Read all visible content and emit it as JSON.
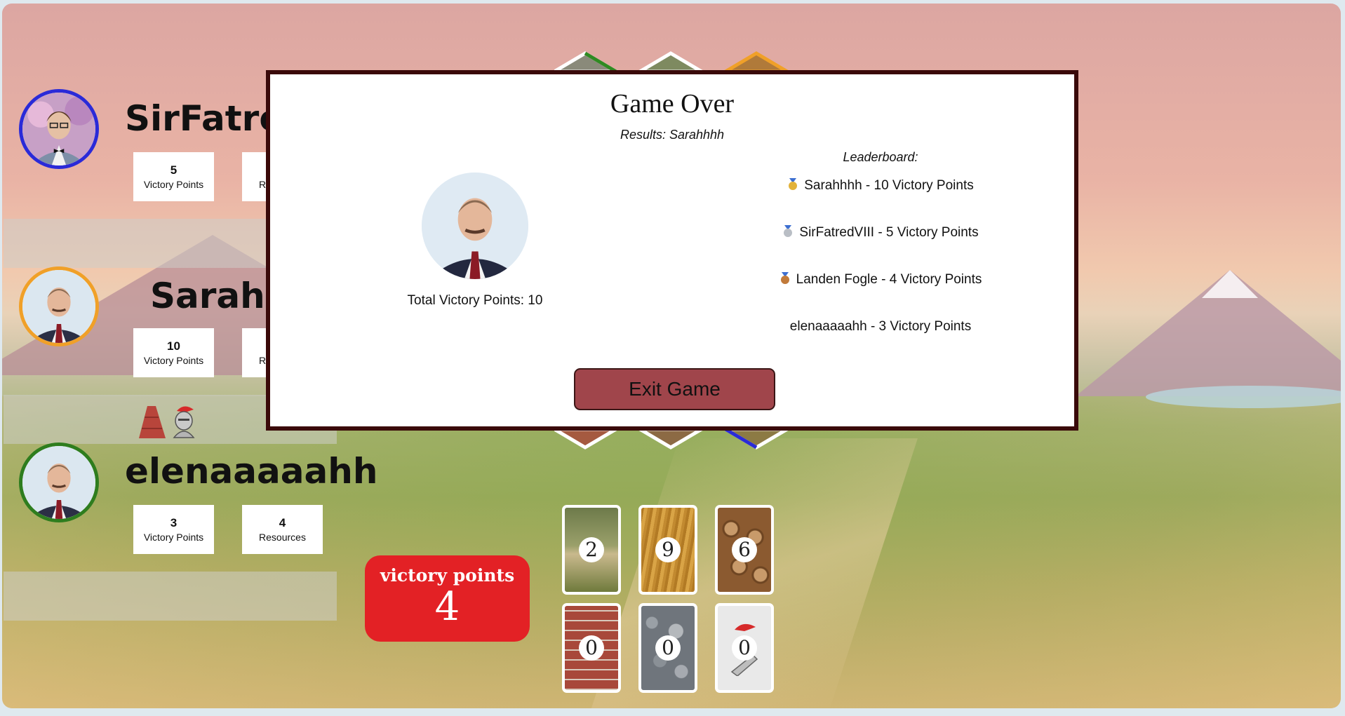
{
  "players": [
    {
      "name": "SirFatred",
      "victory_points": "5",
      "victory_points_label": "Victory Points",
      "resources_label": "R",
      "ring_color": "#2a2ad8"
    },
    {
      "name": "Sarahh",
      "victory_points": "10",
      "victory_points_label": "Victory Points",
      "resources_label": "R",
      "ring_color": "#f0a028"
    },
    {
      "name": "elenaaaaahh",
      "victory_points": "3",
      "victory_points_label": "Victory Points",
      "resources": "4",
      "resources_label": "Resources",
      "ring_color": "#2e7d1e"
    }
  ],
  "victory_box": {
    "label": "victory points",
    "value": "4",
    "color": "#e32125"
  },
  "resource_cards": [
    {
      "icon": "sheep-wool-icon",
      "count": "2"
    },
    {
      "icon": "wheat-icon",
      "count": "9"
    },
    {
      "icon": "lumber-icon",
      "count": "6"
    },
    {
      "icon": "brick-icon",
      "count": "0"
    },
    {
      "icon": "ore-stone-icon",
      "count": "0"
    },
    {
      "icon": "knight-card-icon",
      "count": "0"
    }
  ],
  "modal": {
    "title": "Game Over",
    "results": "Results: Sarahhhh",
    "total_vp": "Total Victory Points: 10",
    "leaderboard_title": "Leaderboard:",
    "leaderboard": [
      {
        "medal": "gold-medal-icon",
        "text": "Sarahhhh - 10 Victory Points"
      },
      {
        "medal": "silver-medal-icon",
        "text": "SirFatredVIII - 5 Victory Points"
      },
      {
        "medal": "bronze-medal-icon",
        "text": "Landen Fogle - 4 Victory Points"
      },
      {
        "medal": "",
        "text": "elenaaaaahh - 3 Victory Points"
      }
    ],
    "exit_label": "Exit Game",
    "exit_color": "#a0454b"
  }
}
